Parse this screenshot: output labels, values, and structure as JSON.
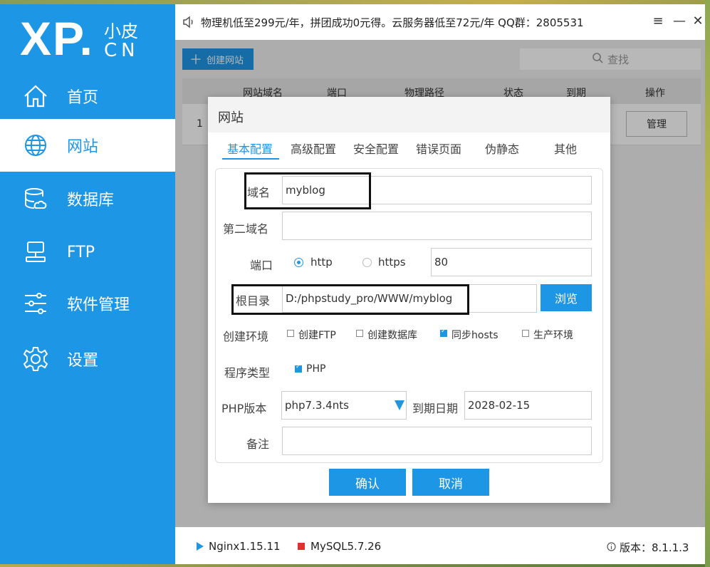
{
  "logo": {
    "main": "XP.",
    "sub_top": "小皮",
    "sub_bottom": "CN"
  },
  "sidebar": {
    "items": [
      {
        "label": "首页",
        "icon": "home-icon"
      },
      {
        "label": "网站",
        "icon": "globe-icon"
      },
      {
        "label": "数据库",
        "icon": "database-icon"
      },
      {
        "label": "FTP",
        "icon": "ftp-icon"
      },
      {
        "label": "软件管理",
        "icon": "sliders-icon"
      },
      {
        "label": "设置",
        "icon": "gear-icon"
      }
    ],
    "active_index": 1
  },
  "topbar": {
    "announcement": "物理机低至299元/年，拼团成功0元得。云服务器低至72元/年  QQ群：2805531",
    "menu_icon": "≡",
    "minimize_icon": "—",
    "close_icon": "✕"
  },
  "toolbar": {
    "create_label": "创建网站",
    "search_placeholder": "查找"
  },
  "table": {
    "headers": [
      "网站域名",
      "端口",
      "物理路径",
      "状态",
      "到期",
      "操作"
    ],
    "rows": [
      {
        "index": "1",
        "action": "管理"
      }
    ]
  },
  "dialog": {
    "title": "网站",
    "tabs": [
      "基本配置",
      "高级配置",
      "安全配置",
      "错误页面",
      "伪静态",
      "其他"
    ],
    "active_tab": 0,
    "fields": {
      "domain_label": "域名",
      "domain_value": "myblog",
      "second_domain_label": "第二域名",
      "second_domain_value": "",
      "port_label": "端口",
      "protocol_http": "http",
      "protocol_https": "https",
      "selected_protocol": "http",
      "port_value": "80",
      "root_label": "根目录",
      "root_value": "D:/phpstudy_pro/WWW/myblog",
      "browse_label": "浏览",
      "env_label": "创建环境",
      "env_options": [
        {
          "label": "创建FTP",
          "checked": false
        },
        {
          "label": "创建数据库",
          "checked": false
        },
        {
          "label": "同步hosts",
          "checked": true
        },
        {
          "label": "生产环境",
          "checked": false
        }
      ],
      "program_label": "程序类型",
      "program_option": {
        "label": "PHP",
        "checked": true
      },
      "php_version_label": "PHP版本",
      "php_version_value": "php7.3.4nts",
      "expire_label": "到期日期",
      "expire_value": "2028-02-15",
      "note_label": "备注",
      "note_value": ""
    },
    "ok_label": "确认",
    "cancel_label": "取消"
  },
  "statusbar": {
    "nginx": "Nginx1.15.11",
    "mysql": "MySQL5.7.26",
    "version": "版本：8.1.1.3"
  },
  "colors": {
    "accent": "#1e96e6",
    "mysql_status": "#e03030"
  }
}
